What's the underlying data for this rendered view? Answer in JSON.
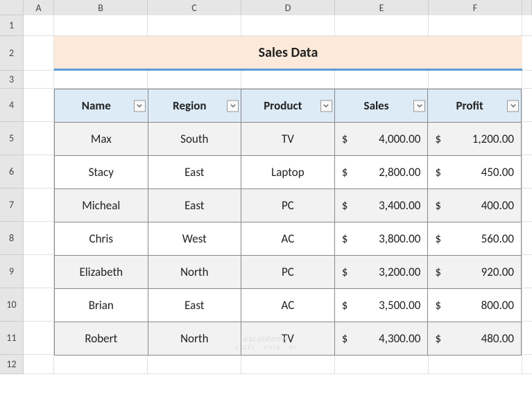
{
  "columns": {
    "labels": [
      "A",
      "B",
      "C",
      "D",
      "E",
      "F"
    ],
    "widths": [
      44,
      135,
      135,
      135,
      135,
      135
    ]
  },
  "rows": {
    "count": 12,
    "heights": [
      30,
      50,
      26,
      48,
      48,
      48,
      48,
      48,
      48,
      48,
      48,
      28
    ]
  },
  "title": "Sales Data",
  "headers": [
    "Name",
    "Region",
    "Product",
    "Sales",
    "Profit"
  ],
  "data": [
    {
      "name": "Max",
      "region": "South",
      "product": "TV",
      "sales": "4,000.00",
      "profit": "1,200.00"
    },
    {
      "name": "Stacy",
      "region": "East",
      "product": "Laptop",
      "sales": "2,800.00",
      "profit": "450.00"
    },
    {
      "name": "Micheal",
      "region": "East",
      "product": "PC",
      "sales": "3,400.00",
      "profit": "400.00"
    },
    {
      "name": "Chris",
      "region": "West",
      "product": "AC",
      "sales": "3,800.00",
      "profit": "560.00"
    },
    {
      "name": "Elizabeth",
      "region": "North",
      "product": "PC",
      "sales": "3,200.00",
      "profit": "920.00"
    },
    {
      "name": "Brian",
      "region": "East",
      "product": "AC",
      "sales": "3,500.00",
      "profit": "800.00"
    },
    {
      "name": "Robert",
      "region": "North",
      "product": "TV",
      "sales": "4,300.00",
      "profit": "480.00"
    }
  ],
  "watermark": {
    "main": "exceldemy",
    "sub": "EXCEL · DATA · BI"
  }
}
